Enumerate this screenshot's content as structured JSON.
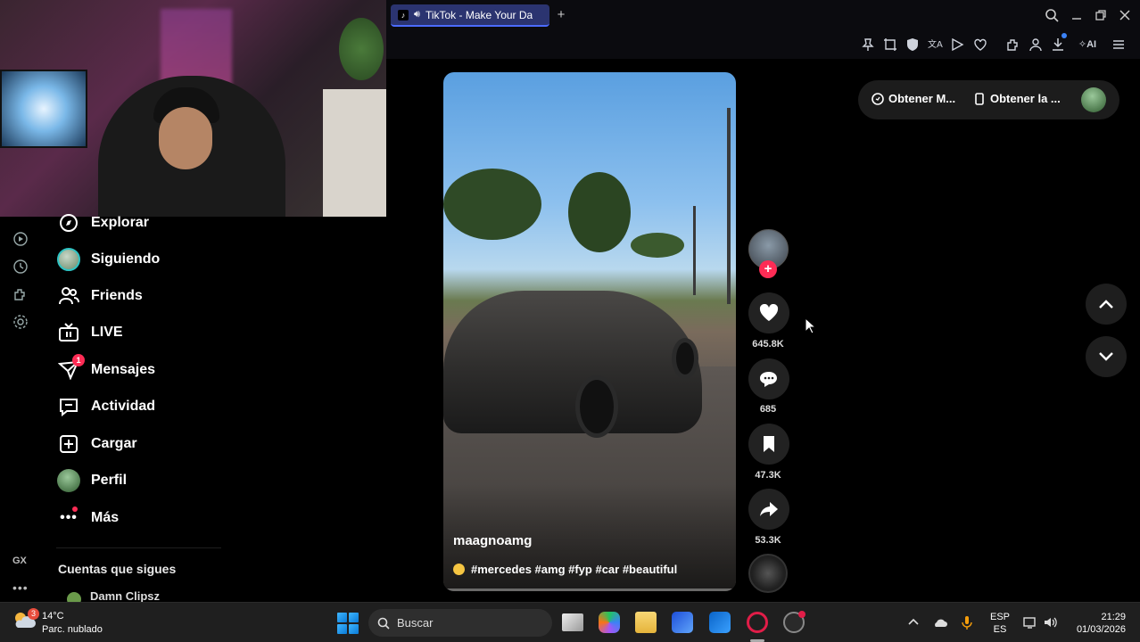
{
  "browser": {
    "tab_title": "TikTok - Make Your Da",
    "toolbar_ai_label": "AI"
  },
  "sidebar": {
    "items": [
      {
        "label": "Explorar",
        "icon": "compass-icon"
      },
      {
        "label": "Siguiendo",
        "icon": "following-avatar"
      },
      {
        "label": "Friends",
        "icon": "friends-icon"
      },
      {
        "label": "LIVE",
        "icon": "live-icon"
      },
      {
        "label": "Mensajes",
        "icon": "messages-icon",
        "badge": "1"
      },
      {
        "label": "Actividad",
        "icon": "activity-icon"
      },
      {
        "label": "Cargar",
        "icon": "upload-icon"
      },
      {
        "label": "Perfil",
        "icon": "profile-avatar"
      },
      {
        "label": "Más",
        "icon": "more-icon"
      }
    ],
    "following_title": "Cuentas que sigues",
    "following": [
      {
        "name": "Damn Clipsz"
      }
    ]
  },
  "topbar": {
    "get_coins": "Obtener M...",
    "get_app": "Obtener la ..."
  },
  "video": {
    "author": "maagnoamg",
    "caption": "#mercedes #amg #fyp #car #beautiful"
  },
  "actions": {
    "likes": "645.8K",
    "comments": "685",
    "saves": "47.3K",
    "shares": "53.3K"
  },
  "taskbar": {
    "weather_temp": "14°C",
    "weather_desc": "Parc. nublado",
    "weather_badge": "3",
    "search_placeholder": "Buscar",
    "lang_top": "ESP",
    "lang_bottom": "ES",
    "time": "21:29",
    "date": "01/03/2026"
  },
  "colors": {
    "tiktok_red": "#fe2c55",
    "tab_active": "#2b3470",
    "page_bg": "#000000",
    "taskbar_bg": "#1f1f1f"
  }
}
